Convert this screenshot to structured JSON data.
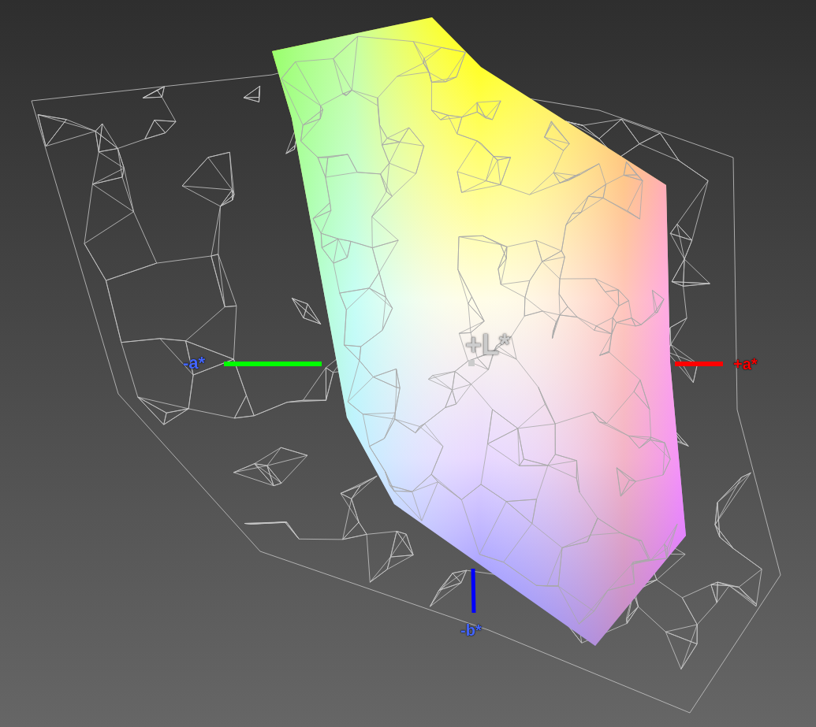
{
  "viewport": {
    "axes": [
      {
        "label": "+L*",
        "color": "#cccccc"
      },
      {
        "label": "-a*",
        "color": "#4466ff"
      },
      {
        "label": "+a*",
        "color": "#ff0000"
      },
      {
        "label": "-b*",
        "color": "#4466ff"
      }
    ]
  }
}
